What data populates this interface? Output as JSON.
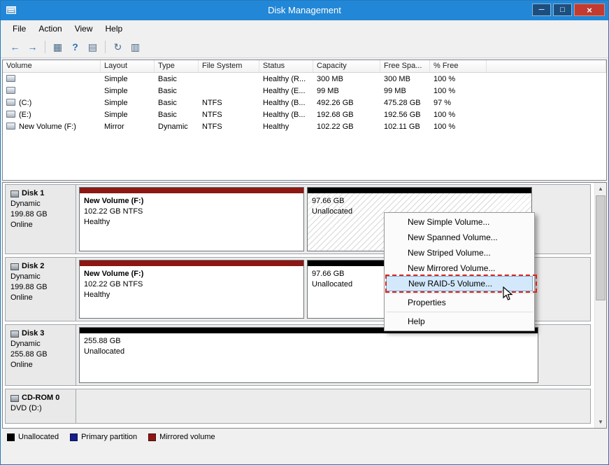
{
  "window": {
    "title": "Disk Management",
    "controls": {
      "minimize": "─",
      "maximize": "□",
      "close": "×"
    }
  },
  "menu_bar": {
    "items": [
      "File",
      "Action",
      "View",
      "Help"
    ]
  },
  "toolbar": {
    "icons": [
      {
        "name": "back",
        "glyph": "←"
      },
      {
        "name": "forward",
        "glyph": "→"
      },
      {
        "name": "show-console-tree",
        "glyph": "▦"
      },
      {
        "name": "help",
        "glyph": "?"
      },
      {
        "name": "export-list",
        "glyph": "▤"
      },
      {
        "name": "refresh",
        "glyph": "↻"
      },
      {
        "name": "rescan-disks",
        "glyph": "▥"
      }
    ]
  },
  "scrollbar": {
    "up": "▲",
    "down": "▼"
  },
  "volume_table": {
    "columns": [
      "Volume",
      "Layout",
      "Type",
      "File System",
      "Status",
      "Capacity",
      "Free Spa...",
      "% Free"
    ],
    "rows": [
      {
        "volume": "",
        "layout": "Simple",
        "type": "Basic",
        "file_system": "",
        "status": "Healthy (R...",
        "capacity": "300 MB",
        "free_space": "300 MB",
        "pct_free": "100 %"
      },
      {
        "volume": "",
        "layout": "Simple",
        "type": "Basic",
        "file_system": "",
        "status": "Healthy (E...",
        "capacity": "99 MB",
        "free_space": "99 MB",
        "pct_free": "100 %"
      },
      {
        "volume": "(C:)",
        "layout": "Simple",
        "type": "Basic",
        "file_system": "NTFS",
        "status": "Healthy (B...",
        "capacity": "492.26 GB",
        "free_space": "475.28 GB",
        "pct_free": "97 %"
      },
      {
        "volume": "(E:)",
        "layout": "Simple",
        "type": "Basic",
        "file_system": "NTFS",
        "status": "Healthy (B...",
        "capacity": "192.68 GB",
        "free_space": "192.56 GB",
        "pct_free": "100 %"
      },
      {
        "volume": "New Volume (F:)",
        "layout": "Mirror",
        "type": "Dynamic",
        "file_system": "NTFS",
        "status": "Healthy",
        "capacity": "102.22 GB",
        "free_space": "102.11 GB",
        "pct_free": "100 %"
      }
    ]
  },
  "disks": [
    {
      "name": "Disk 1",
      "type": "Dynamic",
      "size": "199.88 GB",
      "status": "Online",
      "regions": [
        {
          "title": "New Volume  (F:)",
          "line1": "102.22 GB NTFS",
          "line2": "Healthy",
          "kind": "mirrored"
        },
        {
          "title": "",
          "line1": "97.66 GB",
          "line2": "Unallocated",
          "kind": "unallocated-selected"
        }
      ]
    },
    {
      "name": "Disk 2",
      "type": "Dynamic",
      "size": "199.88 GB",
      "status": "Online",
      "regions": [
        {
          "title": "New Volume  (F:)",
          "line1": "102.22 GB NTFS",
          "line2": "Healthy",
          "kind": "mirrored"
        },
        {
          "title": "",
          "line1": "97.66 GB",
          "line2": "Unallocated",
          "kind": "unallocated"
        }
      ]
    },
    {
      "name": "Disk 3",
      "type": "Dynamic",
      "size": "255.88 GB",
      "status": "Online",
      "regions": [
        {
          "title": "",
          "line1": "255.88 GB",
          "line2": "Unallocated",
          "kind": "unallocated"
        }
      ]
    },
    {
      "name": "CD-ROM 0",
      "type": "DVD (D:)",
      "size": "",
      "status": "",
      "regions": []
    }
  ],
  "context_menu": {
    "items": [
      "New Simple Volume...",
      "New Spanned Volume...",
      "New Striped Volume...",
      "New Mirrored Volume...",
      "New RAID-5 Volume...",
      "Properties",
      "Help"
    ],
    "highlighted_item": "New RAID-5 Volume..."
  },
  "legend": {
    "items": [
      {
        "label": "Unallocated",
        "color": "#000000"
      },
      {
        "label": "Primary partition",
        "color": "#141E8C"
      },
      {
        "label": "Mirrored volume",
        "color": "#8C1713"
      }
    ]
  },
  "colors": {
    "titlebar": "#2287D6",
    "mirrored_bar": "#8C1713",
    "unallocated_bar": "#000000",
    "menu_highlight": "#D3E9FB",
    "annotation_red": "#DB241B"
  }
}
